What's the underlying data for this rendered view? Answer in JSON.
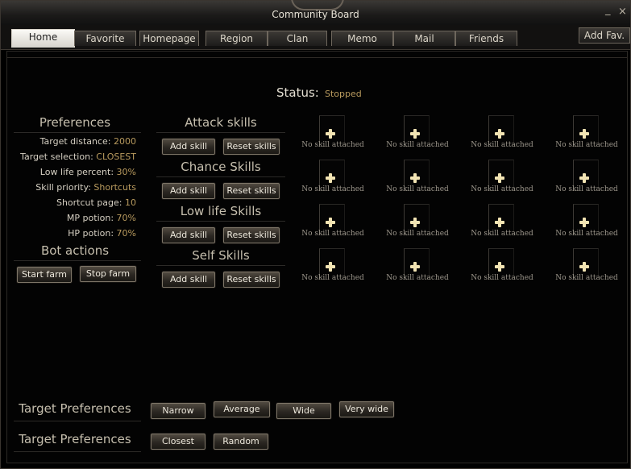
{
  "window": {
    "title": "Community Board",
    "minimize": "_",
    "close": "×"
  },
  "tabs": [
    "Home",
    "Favorite",
    "Homepage",
    "Region",
    "Clan",
    "Memo",
    "Mail",
    "Friends"
  ],
  "add_fav": "Add Fav.",
  "status": {
    "label": "Status:",
    "value": "Stopped"
  },
  "preferences": {
    "title": "Preferences",
    "rows": [
      {
        "label": "Target distance:",
        "value": "2000"
      },
      {
        "label": "Target selection:",
        "value": "CLOSEST"
      },
      {
        "label": "Low life percent:",
        "value": "30%"
      },
      {
        "label": "Skill priority:",
        "value": "Shortcuts"
      },
      {
        "label": "Shortcut page:",
        "value": "10"
      },
      {
        "label": "MP potion:",
        "value": "70%"
      },
      {
        "label": "HP potion:",
        "value": "70%"
      }
    ]
  },
  "bot_actions": {
    "title": "Bot actions",
    "start": "Start farm",
    "stop": "Stop farm"
  },
  "skill_groups": [
    {
      "title": "Attack skills",
      "add": "Add skill",
      "reset": "Reset skills",
      "slots": [
        "No skill attached",
        "No skill attached",
        "No skill attached",
        "No skill attached"
      ]
    },
    {
      "title": "Chance Skills",
      "add": "Add skill",
      "reset": "Reset skills",
      "slots": [
        "No skill attached",
        "No skill attached",
        "No skill attached",
        "No skill attached"
      ]
    },
    {
      "title": "Low life Skills",
      "add": "Add skill",
      "reset": "Reset skills",
      "slots": [
        "No skill attached",
        "No skill attached",
        "No skill attached",
        "No skill attached"
      ]
    },
    {
      "title": "Self Skills",
      "add": "Add skill",
      "reset": "Reset skills",
      "slots": [
        "No skill attached",
        "No skill attached",
        "No skill attached",
        "No skill attached"
      ]
    }
  ],
  "target_range": {
    "title": "Target Preferences",
    "options": [
      "Narrow",
      "Average",
      "Wide",
      "Very wide"
    ]
  },
  "target_order": {
    "title": "Target Preferences",
    "options": [
      "Closest",
      "Random"
    ]
  },
  "icons": {
    "slot_empty": "plus-icon"
  }
}
